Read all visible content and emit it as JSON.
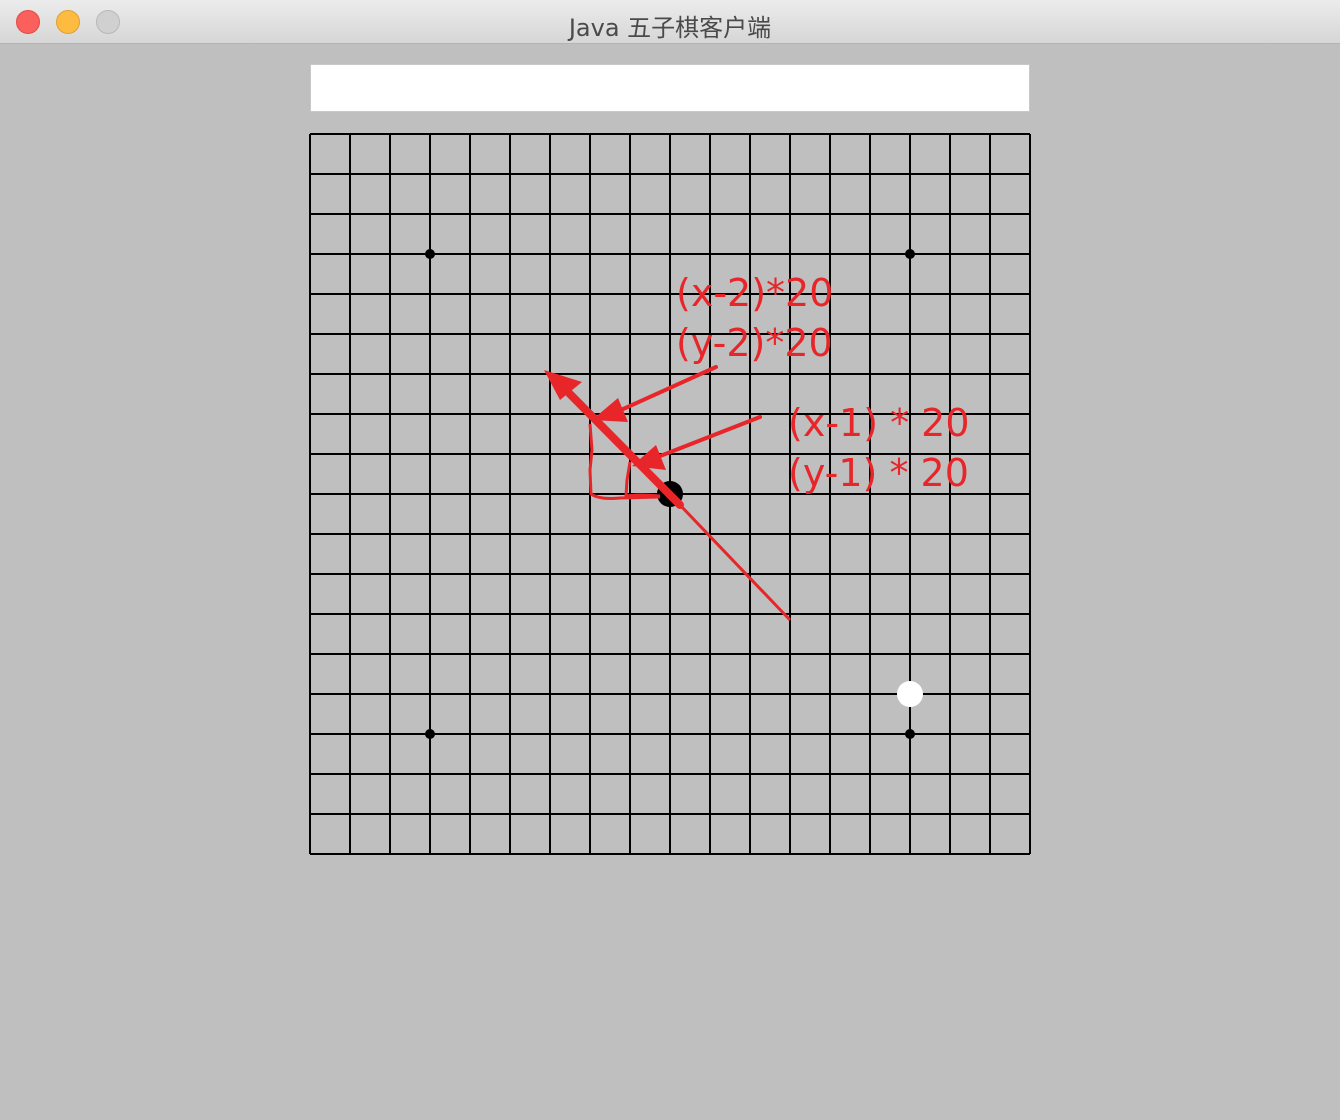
{
  "window": {
    "title": "Java 五子棋客户端"
  },
  "status_field": {
    "value": ""
  },
  "board": {
    "grid_lines": 19,
    "star_points": [
      [
        3,
        3
      ],
      [
        15,
        3
      ],
      [
        3,
        15
      ],
      [
        15,
        15
      ]
    ],
    "stones": [
      {
        "color": "black",
        "col": 9,
        "row": 9
      },
      {
        "color": "white",
        "col": 15,
        "row": 14
      }
    ]
  },
  "annotations": {
    "label_1_line_1": "(x-2)*20",
    "label_1_line_2": "(y-2)*20",
    "label_2_line_1": "(x-1) * 20",
    "label_2_line_2": "(y-1) * 20",
    "color": "#e8262a"
  },
  "colors": {
    "close": "#fc605c",
    "minimize": "#fdbc40",
    "zoom": "#d0d0d0",
    "background": "#bfbfbf",
    "annotation": "#e8262a"
  }
}
